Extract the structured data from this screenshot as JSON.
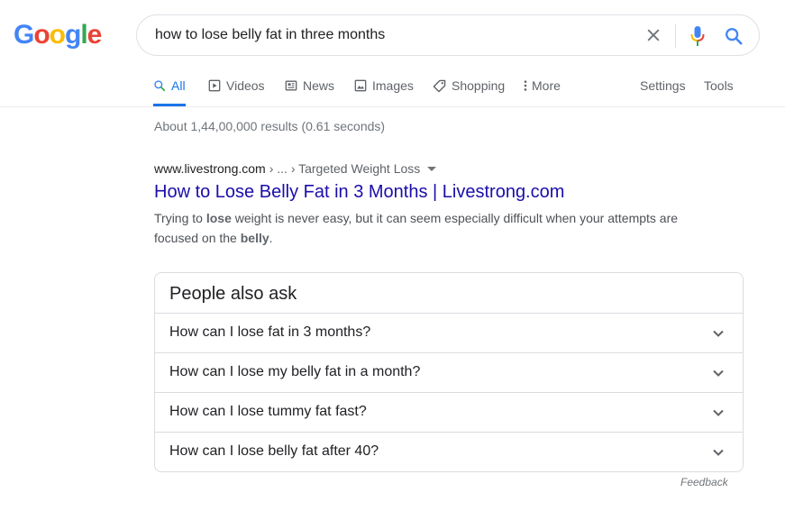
{
  "logo": {
    "letters": [
      "G",
      "o",
      "o",
      "g",
      "l",
      "e"
    ],
    "colors": [
      "#4285f4",
      "#ea4335",
      "#fbbc05",
      "#4285f4",
      "#34a853",
      "#ea4335"
    ]
  },
  "search": {
    "query": "how to lose belly fat in three months"
  },
  "tabs": [
    {
      "label": "All",
      "icon": "search-icon",
      "active": true
    },
    {
      "label": "Videos",
      "icon": "play-icon"
    },
    {
      "label": "News",
      "icon": "newspaper-icon"
    },
    {
      "label": "Images",
      "icon": "image-icon"
    },
    {
      "label": "Shopping",
      "icon": "tag-icon"
    },
    {
      "label": "More",
      "icon": "more-vert-icon"
    }
  ],
  "tools": {
    "settings": "Settings",
    "tools": "Tools"
  },
  "stats": "About 1,44,00,000 results (0.61 seconds)",
  "result": {
    "domain": "www.livestrong.com",
    "crumbs": "› ... › Targeted Weight Loss",
    "title": "How to Lose Belly Fat in 3 Months | Livestrong.com",
    "snippet_1": "Trying to ",
    "snippet_b1": "lose",
    "snippet_2": " weight is never easy, but it can seem especially difficult when your attempts are focused on the ",
    "snippet_b2": "belly",
    "snippet_3": "."
  },
  "paa": {
    "title": "People also ask",
    "questions": [
      "How can I lose fat in 3 months?",
      "How can I lose my belly fat in a month?",
      "How can I lose tummy fat fast?",
      "How can I lose belly fat after 40?"
    ]
  },
  "feedback": "Feedback"
}
